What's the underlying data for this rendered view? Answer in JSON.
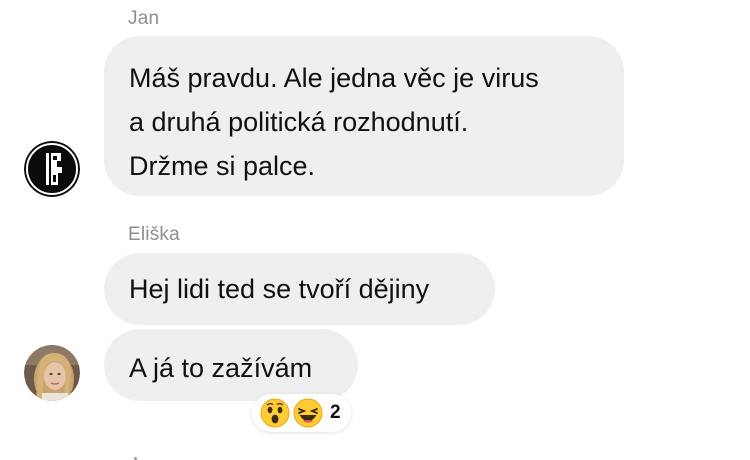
{
  "messages": [
    {
      "sender": "Jan",
      "bubbles": [
        {
          "lines": [
            "Máš pravdu. Ale jedna věc je virus",
            "a druhá politická rozhodnutí.",
            "Držme si palce."
          ]
        }
      ],
      "avatar_icon": "bauhaus-face-logo-icon"
    },
    {
      "sender": "Eliška",
      "bubbles": [
        {
          "lines": [
            "Hej lidi ted se tvoří dějiny"
          ]
        },
        {
          "lines": [
            "A já to zažívám"
          ],
          "reactions": {
            "icons": [
              "wow-face-icon",
              "laughing-face-icon"
            ],
            "count": "2"
          }
        }
      ],
      "avatar_icon": "user-photo-avatar"
    }
  ],
  "colors": {
    "bubble_bg": "#efeff0",
    "sender_name": "#8e8e93",
    "text": "#111111",
    "reaction_face": "#ffcc33"
  }
}
